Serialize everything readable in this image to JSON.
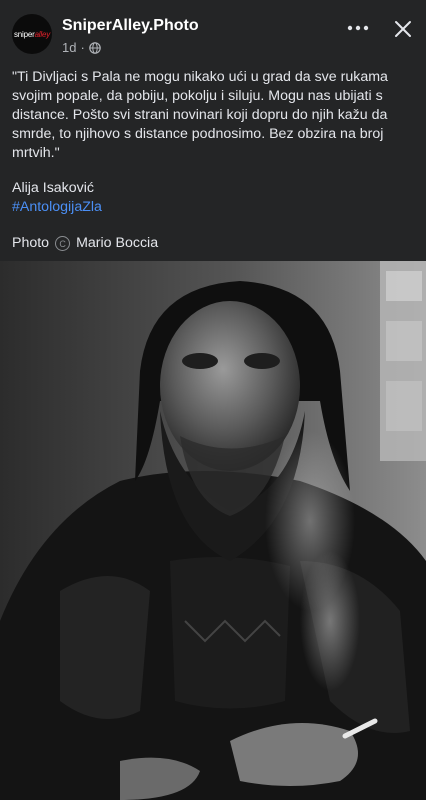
{
  "header": {
    "avatar_text_a": "sniper",
    "avatar_text_b": "alley",
    "page_name": "SniperAlley.Photo",
    "time": "1d",
    "separator": "·",
    "visibility_icon": "globe-icon",
    "more_icon": "more-horizontal-icon",
    "close_icon": "close-icon"
  },
  "post": {
    "caption": "\"Ti Divljaci s Pala ne mogu nikako ući u grad da sve rukama svojim popale, da pobiju, pokolju i siluju. Mogu nas ubijati s distance. Pošto svi strani novinari koji dopru do njih kažu da smrde, to njihovo s distance podnosimo. Bez obzira na broj mrtvih.\"",
    "author": "Alija Isaković",
    "hashtag": "#AntologijaZla",
    "credit_prefix": "Photo",
    "credit_name": "Mario Boccia"
  },
  "colors": {
    "background": "#242526",
    "hashtag": "#4b8ff5",
    "logo_red": "#e0202a"
  }
}
